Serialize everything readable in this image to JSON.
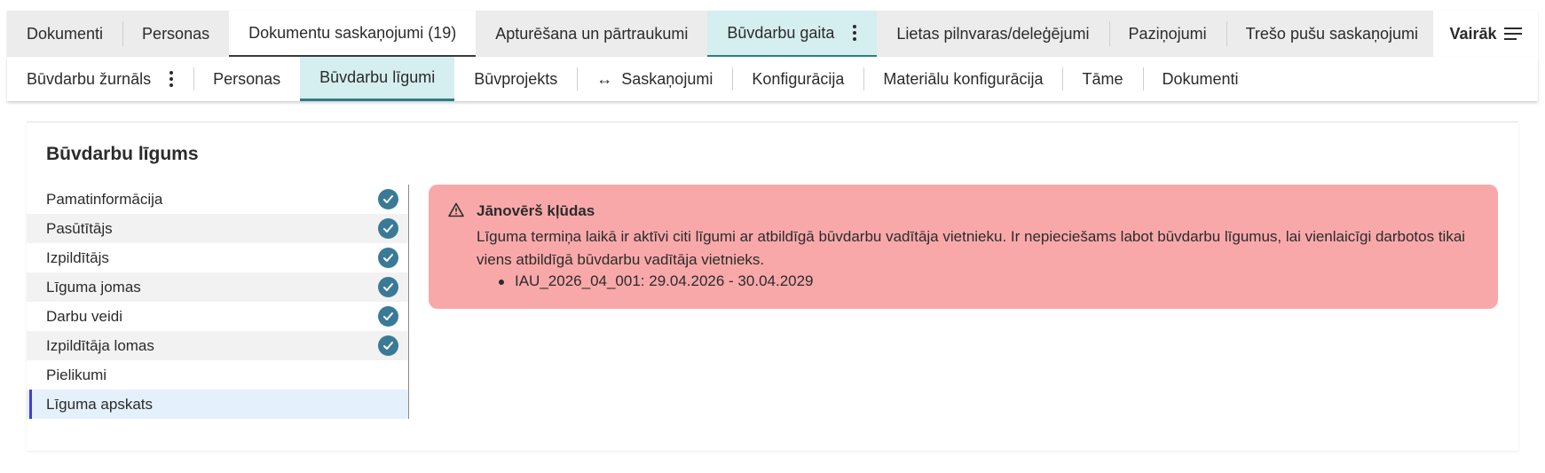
{
  "top_tabs": [
    {
      "label": "Dokumenti"
    },
    {
      "label": "Personas"
    },
    {
      "label": "Dokumentu saskaņojumi (19)"
    },
    {
      "label": "Apturēšana un pārtraukumi"
    },
    {
      "label": "Būvdarbu gaita"
    },
    {
      "label": "Lietas pilnvaras/deleģējumi"
    },
    {
      "label": "Paziņojumi"
    },
    {
      "label": "Trešo pušu saskaņojumi"
    }
  ],
  "more_label": "Vairāk",
  "sub_tabs": [
    {
      "label": "Būvdarbu žurnāls"
    },
    {
      "label": "Personas"
    },
    {
      "label": "Būvdarbu līgumi"
    },
    {
      "label": "Būvprojekts"
    },
    {
      "label": "Saskaņojumi"
    },
    {
      "label": "Konfigurācija"
    },
    {
      "label": "Materiālu konfigurācija"
    },
    {
      "label": "Tāme"
    },
    {
      "label": "Dokumenti"
    }
  ],
  "card_title": "Būvdarbu līgums",
  "steps": [
    {
      "label": "Pamatinformācija",
      "completed": true
    },
    {
      "label": "Pasūtītājs",
      "completed": true
    },
    {
      "label": "Izpildītājs",
      "completed": true
    },
    {
      "label": "Līguma jomas",
      "completed": true
    },
    {
      "label": "Darbu veidi",
      "completed": true
    },
    {
      "label": "Izpildītāja lomas",
      "completed": true
    },
    {
      "label": "Pielikumi",
      "completed": false
    },
    {
      "label": "Līguma apskats",
      "completed": false
    }
  ],
  "alert": {
    "title": "Jānovērš kļūdas",
    "message": "Līguma termiņa laikā ir aktīvi citi līgumi ar atbildīgā būvdarbu vadītāja vietnieku. Ir nepieciešams labot būvdarbu līgumus, lai vienlaicīgi darbotos tikai viens atbildīgā būvdarbu vadītāja vietnieks.",
    "items": [
      "IAU_2026_04_001: 29.04.2026 - 30.04.2029"
    ]
  },
  "colors": {
    "active_tab_teal": "#d5eef0",
    "check_circle": "#3a7a97",
    "alert_background": "#f9a8a9",
    "current_step_bar": "#3f3fd6"
  }
}
